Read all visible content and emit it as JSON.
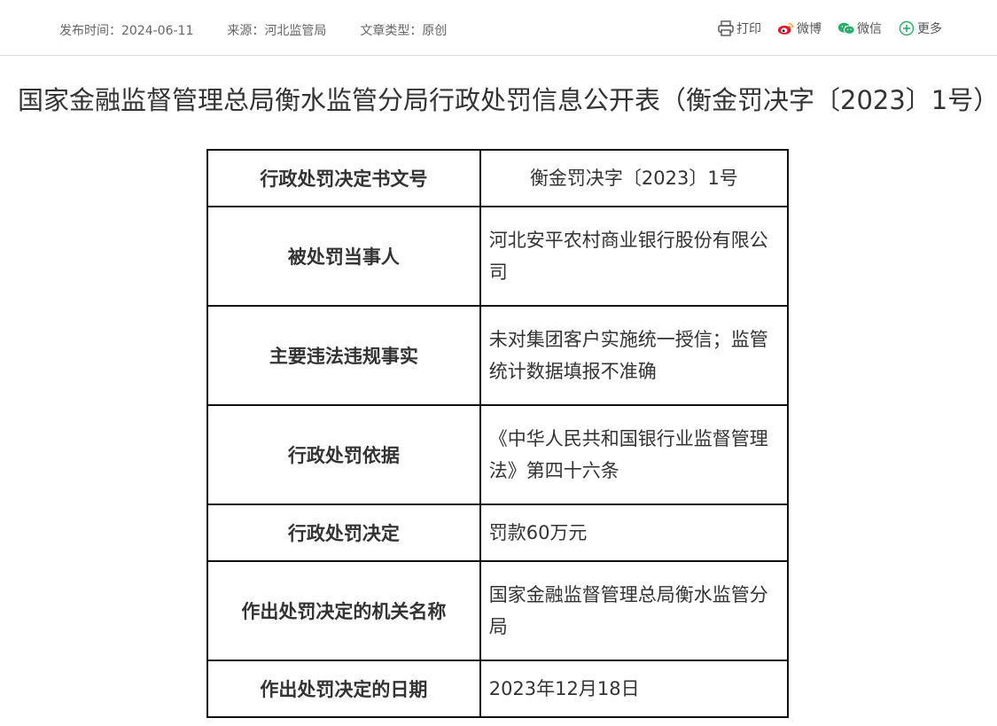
{
  "meta": {
    "publish_time": "发布时间：2024-06-11",
    "source": "来源：河北监管局",
    "article_type": "文章类型：原创"
  },
  "share": {
    "print": "打印",
    "weibo": "微博",
    "wechat": "微信",
    "more": "更多"
  },
  "title": "国家金融监督管理总局衡水监管分局行政处罚信息公开表（衡金罚决字〔2023〕1号）",
  "table": {
    "rows": [
      {
        "label": "行政处罚决定书文号",
        "value": "衡金罚决字〔2023〕1号"
      },
      {
        "label": "被处罚当事人",
        "value": "河北安平农村商业银行股份有限公司"
      },
      {
        "label": "主要违法违规事实",
        "value": "未对集团客户实施统一授信；监管统计数据填报不准确"
      },
      {
        "label": "行政处罚依据",
        "value": "《中华人民共和国银行业监督管理法》第四十六条"
      },
      {
        "label": "行政处罚决定",
        "value": "罚款60万元"
      },
      {
        "label": "作出处罚决定的机关名称",
        "value": "国家金融监督管理总局衡水监管分局"
      },
      {
        "label": "作出处罚决定的日期",
        "value": "2023年12月18日"
      }
    ]
  },
  "colors": {
    "weibo": "#e6162d",
    "wechat": "#2aae67",
    "more": "#2aae67",
    "border": "#111111"
  }
}
